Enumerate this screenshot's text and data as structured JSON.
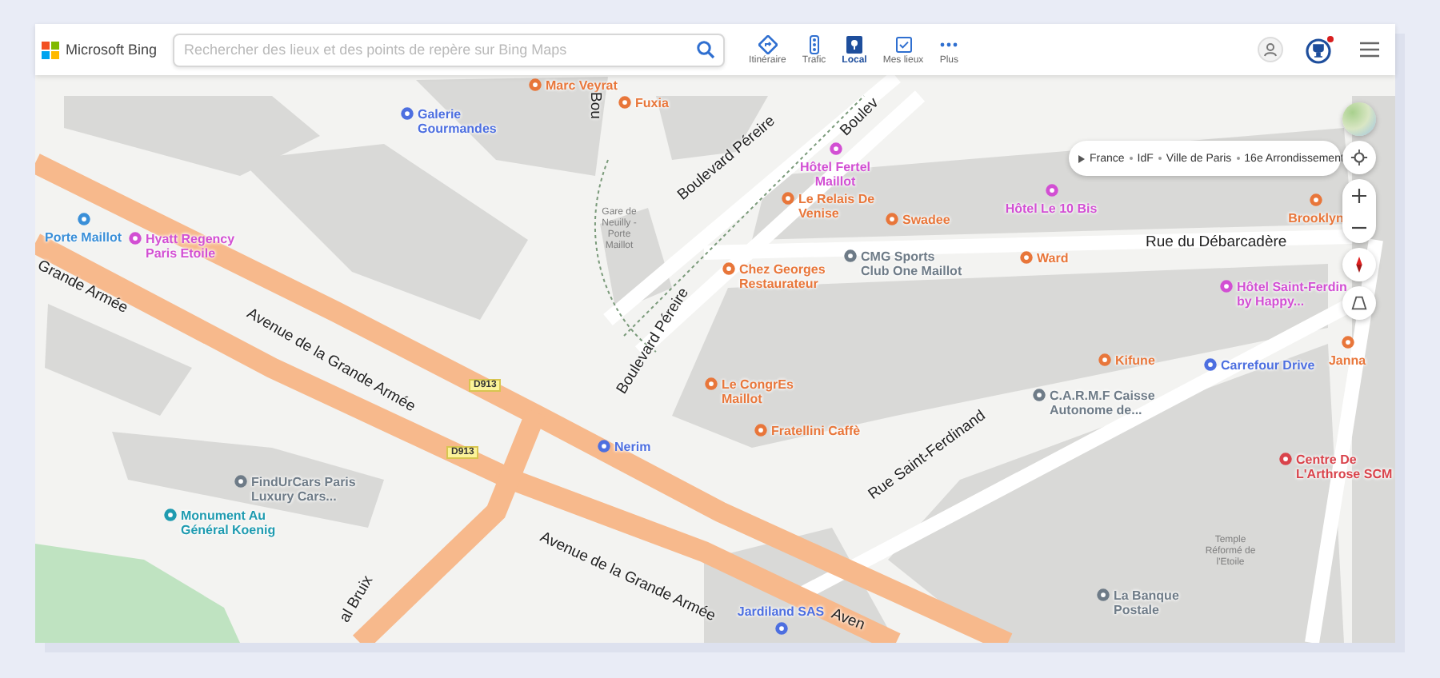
{
  "header": {
    "logo": "Microsoft Bing",
    "search": {
      "placeholder": "Rechercher des lieux et des points de repère sur Bing Maps"
    },
    "nav": [
      {
        "label": "Itinéraire",
        "kind": "route",
        "selected": false
      },
      {
        "label": "Trafic",
        "kind": "traffic",
        "selected": false
      },
      {
        "label": "Local",
        "kind": "local",
        "selected": true
      },
      {
        "label": "Mes lieux",
        "kind": "places",
        "selected": false
      },
      {
        "label": "Plus",
        "kind": "more",
        "selected": false
      }
    ],
    "rewards": {
      "notification": true
    }
  },
  "breadcrumb": [
    "France",
    "IdF",
    "Ville de Paris",
    "16e Arrondissement"
  ],
  "map": {
    "labels": [
      {
        "kind": "poi",
        "text": "Marc Veyrat",
        "color": "#e8763a"
      },
      {
        "kind": "poi",
        "text": "Galerie Gourmandes",
        "color": "#4d6fe0"
      },
      {
        "kind": "street",
        "text": "Bou"
      },
      {
        "kind": "poi",
        "text": "Fuxia",
        "color": "#e8763a"
      },
      {
        "kind": "street",
        "text": "Boulevard Péreire"
      },
      {
        "kind": "street",
        "text": "Boulev"
      },
      {
        "kind": "poi",
        "text": "Hôtel Fertel Maillot",
        "color": "#d24fd3"
      },
      {
        "kind": "poi",
        "text": "Le Relais De Venise",
        "color": "#e8763a"
      },
      {
        "kind": "poi",
        "text": "Swadee",
        "color": "#e8763a"
      },
      {
        "kind": "poi",
        "text": "Hôtel Le 10 Bis",
        "color": "#d24fd3"
      },
      {
        "kind": "poi",
        "text": "Brooklyn",
        "color": "#e8763a"
      },
      {
        "kind": "poi",
        "text": "Porte Maillot",
        "color": "#3a8fd8"
      },
      {
        "kind": "poi",
        "text": "Hyatt Regency Paris Etoile",
        "color": "#d24fd3"
      },
      {
        "kind": "street",
        "text": "Grande Armée"
      },
      {
        "kind": "note",
        "text": "Gare de Neuilly - Porte Maillot"
      },
      {
        "kind": "street",
        "text": "Avenue de la Grande Armée"
      },
      {
        "kind": "street",
        "text": "Rue du Débarcadère"
      },
      {
        "kind": "poi",
        "text": "CMG Sports Club One Maillot",
        "color": "#6e7b87"
      },
      {
        "kind": "poi",
        "text": "Ward",
        "color": "#e8763a"
      },
      {
        "kind": "poi",
        "text": "Chez Georges Restaurateur",
        "color": "#e8763a"
      },
      {
        "kind": "poi",
        "text": "Hôtel Saint-Ferdin by Happy...",
        "color": "#d24fd3"
      },
      {
        "kind": "street",
        "text": "Boulevard Péreire"
      },
      {
        "kind": "poi",
        "text": "Kifune",
        "color": "#e8763a"
      },
      {
        "kind": "poi",
        "text": "Carrefour Drive",
        "color": "#4d6fe0"
      },
      {
        "kind": "poi",
        "text": "Janna",
        "color": "#e8763a"
      },
      {
        "kind": "shield",
        "text": "D913"
      },
      {
        "kind": "poi",
        "text": "Le CongrEs Maillot",
        "color": "#e8763a"
      },
      {
        "kind": "poi",
        "text": "C.A.R.M.F Caisse Autonome de...",
        "color": "#6e7b87"
      },
      {
        "kind": "poi",
        "text": "Fratellini Caffè",
        "color": "#e8763a"
      },
      {
        "kind": "poi",
        "text": "Nerim",
        "color": "#4d6fe0"
      },
      {
        "kind": "shield",
        "text": "D913"
      },
      {
        "kind": "poi",
        "text": "Centre De L'Arthrose SCM",
        "color": "#d9434b"
      },
      {
        "kind": "street",
        "text": "Rue Saint-Ferdinand"
      },
      {
        "kind": "poi",
        "text": "FindUrCars Paris Luxury Cars...",
        "color": "#6e7b87"
      },
      {
        "kind": "poi",
        "text": "Monument Au Général Koenig",
        "color": "#1f9bb0"
      },
      {
        "kind": "street",
        "text": "Avenue de la Grande Armée"
      },
      {
        "kind": "note",
        "text": "Temple Réformé de l'Etoile"
      },
      {
        "kind": "poi",
        "text": "Jardiland SAS",
        "color": "#4d6fe0"
      },
      {
        "kind": "poi",
        "text": "La Banque Postale",
        "color": "#6e7b87"
      },
      {
        "kind": "street",
        "text": "al Bruix"
      },
      {
        "kind": "street",
        "text": "Aven"
      }
    ]
  }
}
